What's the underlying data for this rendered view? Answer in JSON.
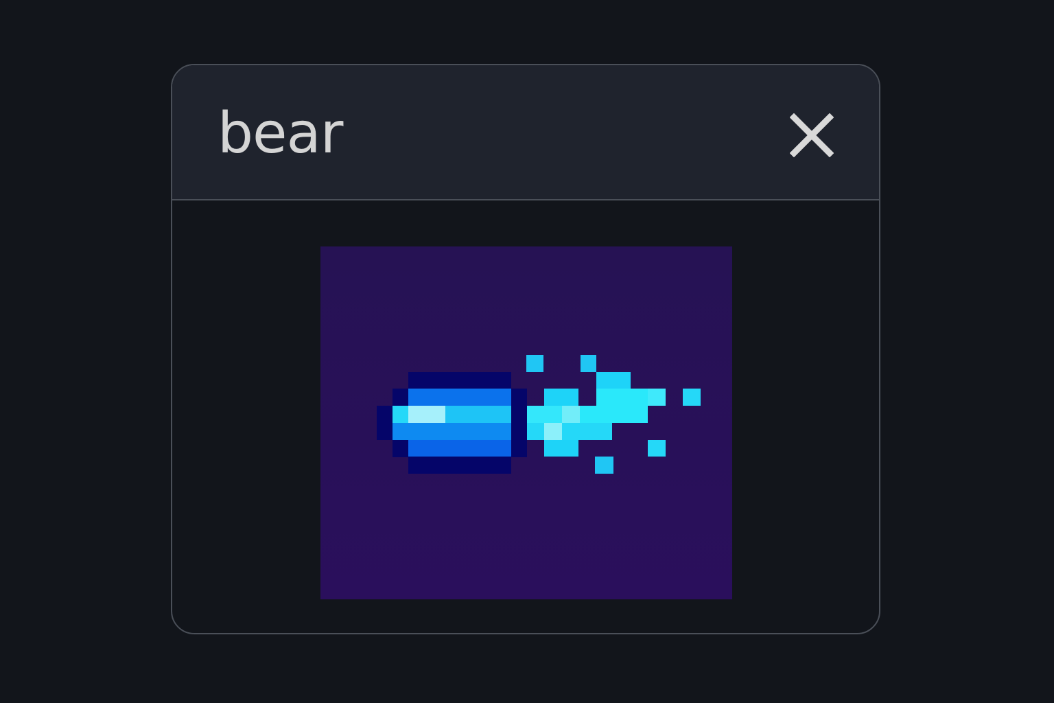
{
  "dialog": {
    "title": "bear",
    "close_icon": "close-icon",
    "preview_icon": "pixel-comet-icon"
  },
  "colors": {
    "background": "#12151b",
    "header": "#1f232d",
    "border": "#4a4f58",
    "title_text": "#d4d4d4",
    "preview_bg": "#281257",
    "comet_dark": "#050569",
    "comet_blue": "#0b72ec",
    "comet_light": "#1ea5f5",
    "comet_highlight": "#a6f0fb",
    "spark": "#25e1f7"
  }
}
